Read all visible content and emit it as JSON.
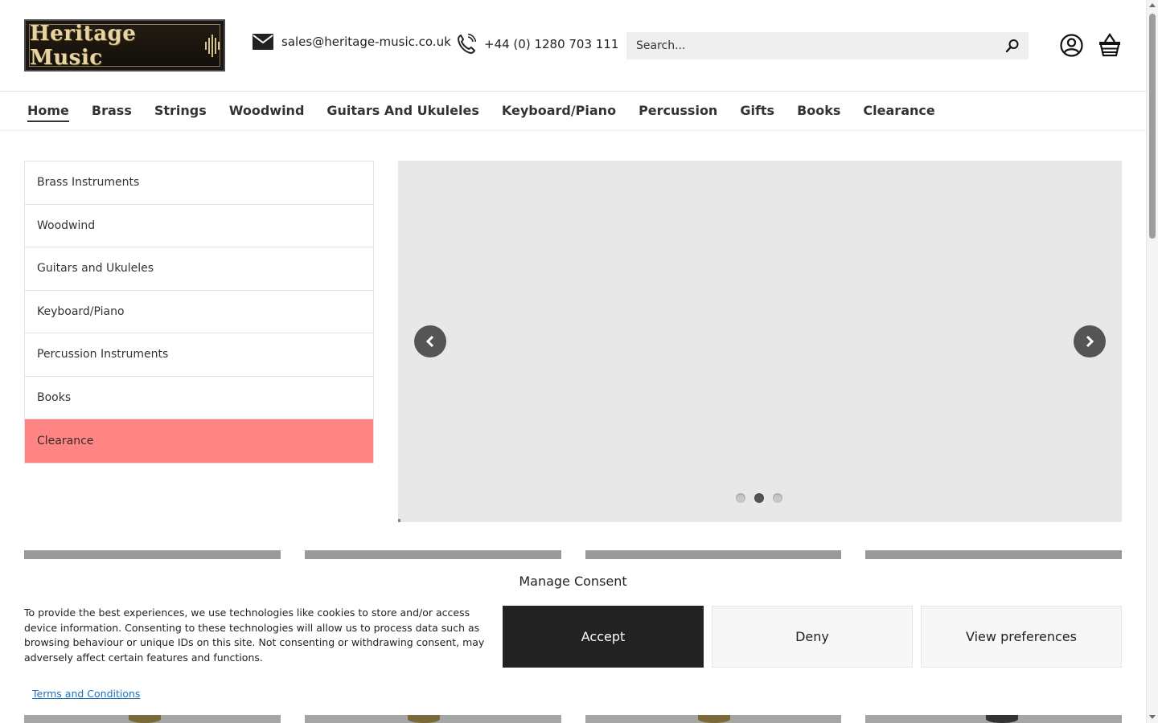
{
  "header": {
    "logo_text": "Heritage Music",
    "email": "sales@heritage-music.co.uk",
    "phone": "+44 (0) 1280 703 111",
    "search_placeholder": "Search..."
  },
  "nav": {
    "items": [
      {
        "label": "Home"
      },
      {
        "label": "Brass"
      },
      {
        "label": "Strings"
      },
      {
        "label": "Woodwind"
      },
      {
        "label": "Guitars And Ukuleles"
      },
      {
        "label": "Keyboard/Piano"
      },
      {
        "label": "Percussion"
      },
      {
        "label": "Gifts"
      },
      {
        "label": "Books"
      },
      {
        "label": "Clearance"
      }
    ],
    "active": "Home"
  },
  "sidebar": {
    "items": [
      {
        "label": "Brass Instruments"
      },
      {
        "label": "Woodwind"
      },
      {
        "label": "Guitars and Ukuleles"
      },
      {
        "label": "Keyboard/Piano"
      },
      {
        "label": "Percussion Instruments"
      },
      {
        "label": "Books"
      },
      {
        "label": "Clearance"
      }
    ],
    "highlight_color": "#ff8585"
  },
  "slider": {
    "slide_count": 3,
    "active_slide": 2
  },
  "consent": {
    "title": "Manage Consent",
    "text": "To provide the best experiences, we use technologies like cookies to store and/or access device information. Consenting to these technologies will allow us to process data such as browsing behaviour or unique IDs on this site. Not consenting or withdrawing consent, may adversely affect certain features and functions.",
    "accept_label": "Accept",
    "deny_label": "Deny",
    "preferences_label": "View preferences",
    "terms_link": "Terms and Conditions"
  },
  "colors": {
    "accept_bg": "#222222",
    "link": "#1e73be"
  }
}
